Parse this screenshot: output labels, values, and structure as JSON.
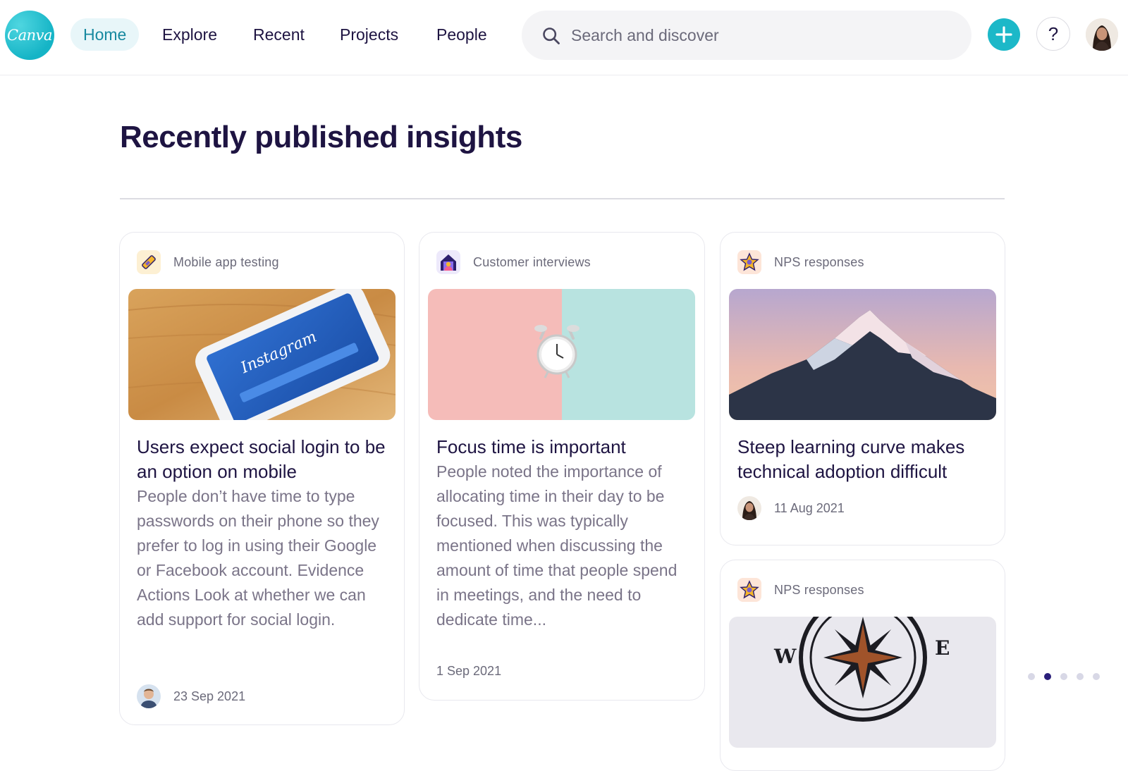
{
  "app": {
    "logo_text": "Canva",
    "brand_color": "#1cb8c8"
  },
  "nav": {
    "items": [
      {
        "label": "Home",
        "active": true
      },
      {
        "label": "Explore"
      },
      {
        "label": "Recent"
      },
      {
        "label": "Projects"
      },
      {
        "label": "People"
      }
    ],
    "search_placeholder": "Search and discover",
    "help_label": "?",
    "icons": [
      "search-icon",
      "plus-icon",
      "help-icon",
      "user-avatar"
    ]
  },
  "page": {
    "title": "Recently published insights"
  },
  "cards": [
    {
      "tag": "Mobile app testing",
      "tag_icon": "pencil-icon",
      "image": "phone-instagram-login",
      "image_text": "Instagram",
      "title": "Users expect social login to be an option on mobile",
      "body": "People don’t have time to type passwords on their phone so they prefer to log in using their Google or Facebook account. Evidence Actions Look at whether we can add support for social login.",
      "date": "23 Sep 2021"
    },
    {
      "tag": "Customer interviews",
      "tag_icon": "house-person-icon",
      "image": "alarm-clock-pink-teal",
      "title": "Focus time is important",
      "body": "People noted the importance of allocating time in their day to be focused. This was typically mentioned when discussing the amount of time that people spend in meetings, and the need to dedicate time...",
      "date": "1 Sep 2021"
    },
    {
      "tag": "NPS responses",
      "tag_icon": "star-badge-icon",
      "image": "snowy-mountain-peak",
      "title": "Steep learning curve makes technical adoption difficult",
      "date": "11 Aug 2021"
    },
    {
      "tag": "NPS responses",
      "tag_icon": "star-badge-icon",
      "image": "compass-rose",
      "compass_w": "W",
      "compass_e": "E"
    }
  ],
  "pagination": {
    "count": 5,
    "active_index": 1
  },
  "colors": {
    "heading": "#1e1442",
    "muted": "#7a7488",
    "active_nav_bg": "#e8f6f9",
    "active_nav_text": "#1789a0"
  }
}
